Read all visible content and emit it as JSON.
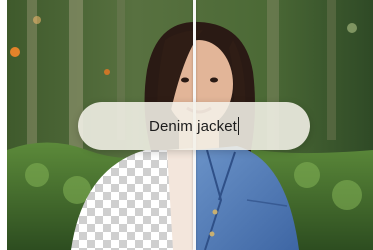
{
  "editor": {
    "prompt": {
      "value": "Denim jacket"
    },
    "divider_icon": "vertical-split-line"
  }
}
